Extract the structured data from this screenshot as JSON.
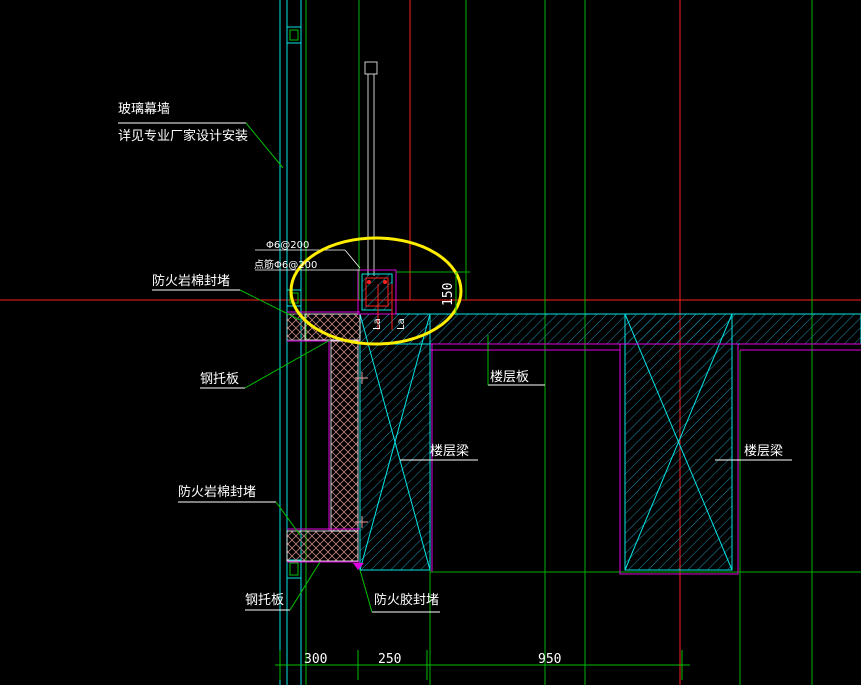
{
  "labels": {
    "curtain_wall_line1": "玻璃幕墙",
    "curtain_wall_line2": "详见专业厂家设计安装",
    "rebar_top": "Φ6@200",
    "rebar_bottom": "点筋Φ6@200",
    "fire_rockwool_top": "防火岩棉封堵",
    "steel_plate_top": "钢托板",
    "floor_slab": "楼层板",
    "floor_beam_left": "楼层梁",
    "floor_beam_right": "楼层梁",
    "fire_rockwool_bottom": "防火岩棉封堵",
    "steel_plate_bottom": "钢托板",
    "fire_sealant": "防火胶封堵",
    "la_1": "La",
    "la_2": "La"
  },
  "dimensions": {
    "height_150": "150",
    "width_300": "300",
    "width_250": "250",
    "width_950": "950"
  },
  "colors": {
    "background": "#000000",
    "cyan": "#00e5e5",
    "green": "#00c000",
    "magenta": "#e000e0",
    "red": "#ff2020",
    "yellow_highlight": "#ffee00",
    "text": "#ffffff",
    "hatch": "#00a0c0"
  }
}
